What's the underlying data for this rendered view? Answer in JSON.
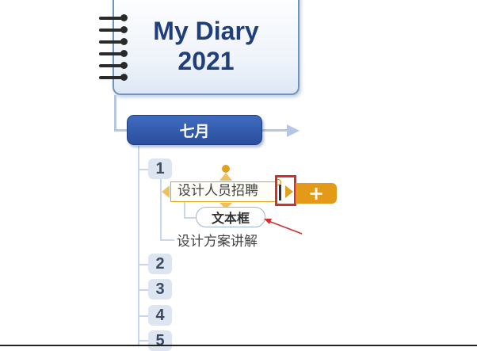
{
  "root_topic": {
    "title_line1": "My Diary",
    "title_line2": "2021",
    "icon": "spiral-notebook-binding"
  },
  "month_topic": {
    "label": "七月"
  },
  "days": [
    {
      "label": "1"
    },
    {
      "label": "2"
    },
    {
      "label": "3"
    },
    {
      "label": "4"
    },
    {
      "label": "5"
    }
  ],
  "day1_children": {
    "selected_topic": "设计人员招聘",
    "callout_label": "文本框",
    "second_topic": "设计方案讲解"
  },
  "add_button": {
    "label": "+",
    "icon": "plus-icon"
  },
  "colors": {
    "root_border": "#7094c0",
    "title_text": "#1f3f7a",
    "month_fill": "#2f58a8",
    "selection": "#e0a020",
    "add_button": "#e39a18",
    "annotation_red": "#d23030"
  }
}
